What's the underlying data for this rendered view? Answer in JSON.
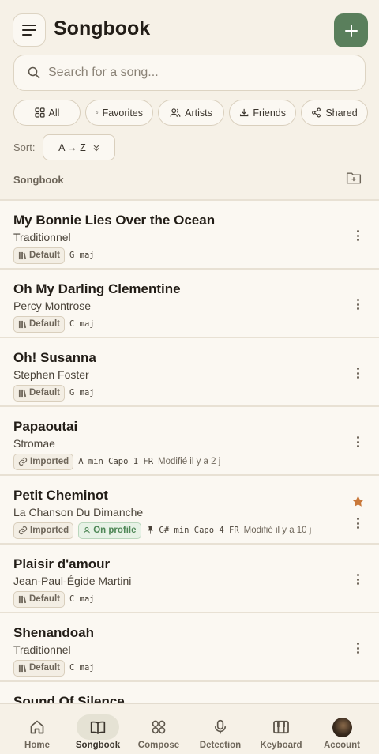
{
  "header": {
    "title": "Songbook"
  },
  "search": {
    "placeholder": "Search for a song..."
  },
  "filters": [
    {
      "label": "All",
      "icon": "grid-icon"
    },
    {
      "label": "Favorites",
      "icon": "star-icon"
    },
    {
      "label": "Artists",
      "icon": "people-icon"
    },
    {
      "label": "Friends",
      "icon": "download-icon"
    },
    {
      "label": "Shared",
      "icon": "share-icon"
    }
  ],
  "sort": {
    "label": "Sort:",
    "value": "A → Z"
  },
  "section": {
    "label": "Songbook"
  },
  "songs": [
    {
      "title": "My Bonnie Lies Over the Ocean",
      "artist": "Traditionnel",
      "badge": "Default",
      "key": "G maj"
    },
    {
      "title": "Oh My Darling Clementine",
      "artist": "Percy Montrose",
      "badge": "Default",
      "key": "C maj"
    },
    {
      "title": "Oh! Susanna",
      "artist": "Stephen Foster",
      "badge": "Default",
      "key": "G maj"
    },
    {
      "title": "Papaoutai",
      "artist": "Stromae",
      "badge": "Imported",
      "key": "A min Capo 1 FR",
      "modified": "Modifié il y a 2 j"
    },
    {
      "title": "Petit Cheminot",
      "artist": "La Chanson Du Dimanche",
      "badge": "Imported",
      "profile_badge": "On profile",
      "key": "G# min Capo 4 FR",
      "modified": "Modifié il y a 10 j",
      "favorite": true
    },
    {
      "title": "Plaisir d'amour",
      "artist": "Jean-Paul-Égide Martini",
      "badge": "Default",
      "key": "C maj"
    },
    {
      "title": "Shenandoah",
      "artist": "Traditionnel",
      "badge": "Default",
      "key": "C maj"
    },
    {
      "title": "Sound Of Silence",
      "artist": "",
      "badge": "",
      "key": ""
    }
  ],
  "nav": [
    {
      "label": "Home",
      "icon": "home-icon"
    },
    {
      "label": "Songbook",
      "icon": "book-icon",
      "active": true
    },
    {
      "label": "Compose",
      "icon": "grid-icon"
    },
    {
      "label": "Detection",
      "icon": "microphone-icon"
    },
    {
      "label": "Keyboard",
      "icon": "piano-icon"
    },
    {
      "label": "Account",
      "icon": "avatar"
    }
  ],
  "colors": {
    "accent": "#5a7f5c",
    "favorite": "#c9783a",
    "background": "#f6f1e7"
  }
}
